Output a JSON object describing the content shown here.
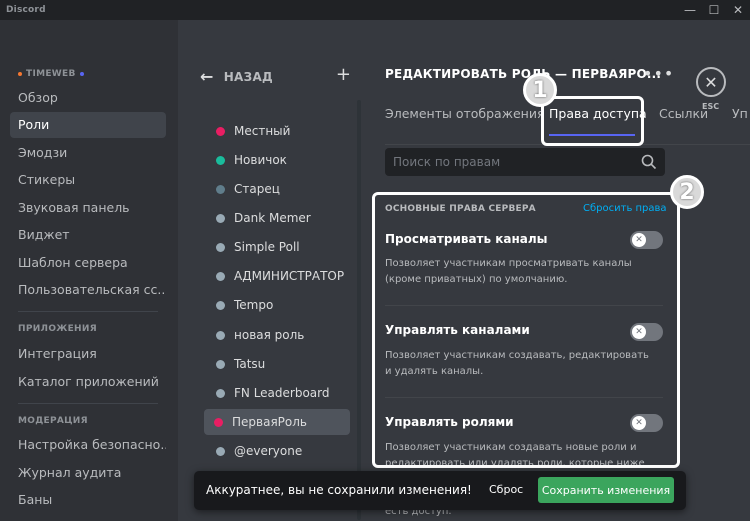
{
  "window": {
    "title": "Discord",
    "controls": [
      "minimize-icon",
      "maximize-icon",
      "close-icon"
    ]
  },
  "sidebar": {
    "server_header": "TIMEWEB",
    "server_items": [
      {
        "label": "Обзор"
      },
      {
        "label": "Роли",
        "active": true
      },
      {
        "label": "Эмодзи"
      },
      {
        "label": "Стикеры"
      },
      {
        "label": "Звуковая панель"
      },
      {
        "label": "Виджет"
      },
      {
        "label": "Шаблон сервера"
      },
      {
        "label": "Пользовательская сс..."
      }
    ],
    "apps_header": "ПРИЛОЖЕНИЯ",
    "apps_items": [
      {
        "label": "Интеграция"
      },
      {
        "label": "Каталог приложений"
      }
    ],
    "moderation_header": "МОДЕРАЦИЯ",
    "moderation_items": [
      {
        "label": "Настройка безопасно..."
      },
      {
        "label": "Журнал аудита"
      },
      {
        "label": "Баны"
      }
    ]
  },
  "roles_panel": {
    "back_label": "НАЗАД",
    "roles": [
      {
        "name": "Местный",
        "color": "#e91e63"
      },
      {
        "name": "Новичок",
        "color": "#1abc9c"
      },
      {
        "name": "Старец",
        "color": "#607d8b"
      },
      {
        "name": "Dank Memer",
        "color": "#99aab5"
      },
      {
        "name": "Simple Poll",
        "color": "#99aab5"
      },
      {
        "name": "АДМИНИСТРАТОР",
        "color": "#99aab5"
      },
      {
        "name": "Tempo",
        "color": "#99aab5"
      },
      {
        "name": "новая роль",
        "color": "#99aab5"
      },
      {
        "name": "Tatsu",
        "color": "#99aab5"
      },
      {
        "name": "FN Leaderboard",
        "color": "#99aab5"
      },
      {
        "name": "ПерваяРоль",
        "color": "#e91e63",
        "active": true
      },
      {
        "name": "@everyone",
        "color": "#99aab5"
      }
    ]
  },
  "editor": {
    "title": "РЕДАКТИРОВАТЬ РОЛЬ — ПЕРВАЯРО...",
    "esc_label": "ESC",
    "tabs": [
      {
        "label": "Элементы отображения"
      },
      {
        "label": "Права доступа",
        "active": true
      },
      {
        "label": "Ссылки"
      },
      {
        "label": "Уп"
      }
    ],
    "search_placeholder": "Поиск по правам",
    "section_title": "ОСНОВНЫЕ ПРАВА СЕРВЕРА",
    "reset_label": "Сбросить права",
    "permissions": [
      {
        "name": "Просматривать каналы",
        "description": "Позволяет участникам просматривать каналы (кроме приватных) по умолчанию.",
        "enabled": false
      },
      {
        "name": "Управлять каналами",
        "description": "Позволяет участникам создавать, редактировать и удалять каналы.",
        "enabled": false
      },
      {
        "name": "Управлять ролями",
        "description": "Позволяет участникам создавать новые роли и редактировать или удалять роли, которые ниже их",
        "enabled": false
      }
    ],
    "tail_text": "есть доступ."
  },
  "annotations": {
    "badge_1": "1",
    "badge_2": "2"
  },
  "unsaved_bar": {
    "message": "Аккуратнее, вы не сохранили изменения!",
    "reset_label": "Сброс",
    "save_label": "Сохранить изменения"
  },
  "colors": {
    "accent": "#5865f2",
    "save_green": "#3ba55d",
    "link_blue": "#00aff4"
  }
}
